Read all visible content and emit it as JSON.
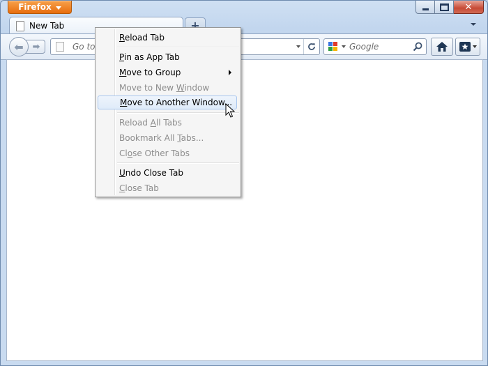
{
  "app": {
    "menu_button": "Firefox"
  },
  "window_controls": {
    "minimize": "minimize-icon",
    "maximize": "maximize-icon",
    "close": "close-icon"
  },
  "tabs": [
    {
      "title": "New Tab"
    }
  ],
  "new_tab": {
    "label": "+"
  },
  "nav": {
    "url_placeholder": "Go to a Website",
    "search_placeholder": "Google",
    "search_engine": "Google"
  },
  "context_menu": {
    "items": [
      {
        "label": "Reload Tab",
        "access": "R",
        "enabled": true
      },
      {
        "label": "Pin as App Tab",
        "access": "P",
        "enabled": true
      },
      {
        "label": "Move to Group",
        "access": "M",
        "enabled": true,
        "submenu": true
      },
      {
        "label": "Move to New Window",
        "access": "W",
        "enabled": false
      },
      {
        "label": "Move to Another Window...",
        "access": "M",
        "enabled": true,
        "hovered": true
      },
      {
        "label": "Reload All Tabs",
        "access": "A",
        "enabled": false
      },
      {
        "label": "Bookmark All Tabs...",
        "access": "T",
        "enabled": false
      },
      {
        "label": "Close Other Tabs",
        "access": "o",
        "enabled": false
      },
      {
        "label": "Undo Close Tab",
        "access": "U",
        "enabled": true
      },
      {
        "label": "Close Tab",
        "access": "C",
        "enabled": false
      }
    ]
  },
  "colors": {
    "firefox_orange": "#e86c0d",
    "chrome_blue": "#c2d6ee",
    "menu_hover": "#dfebf9"
  }
}
